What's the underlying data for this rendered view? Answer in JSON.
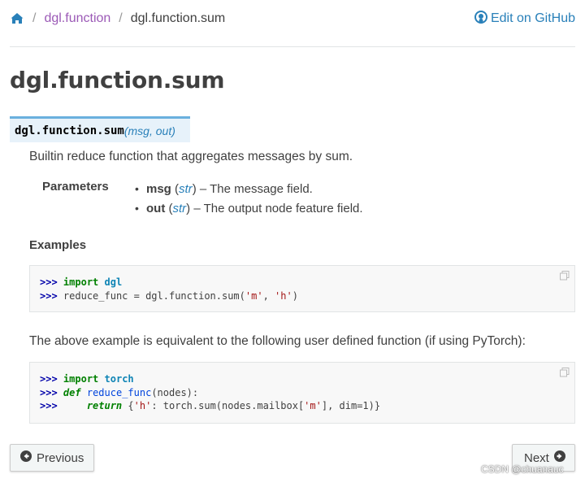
{
  "breadcrumb": {
    "parent": "dgl.function",
    "current": "dgl.function.sum",
    "separator": "/",
    "github": "Edit on GitHub"
  },
  "page_title": "dgl.function.sum",
  "signature": {
    "name": "dgl.function.sum",
    "params": "(msg, out)"
  },
  "description": "Builtin reduce function that aggregates messages by sum.",
  "parameters": {
    "label": "Parameters",
    "items": [
      {
        "name": "msg",
        "type": "str",
        "desc": "– The message field."
      },
      {
        "name": "out",
        "type": "str",
        "desc": "– The output node feature field."
      }
    ]
  },
  "examples_heading": "Examples",
  "code1": {
    "lines": [
      {
        "prompt": ">>>",
        "kw": "import",
        "rest": " ",
        "mod": "dgl"
      },
      {
        "prompt": ">>>",
        "text": "reduce_func = dgl.function.sum(",
        "s1": "'m'",
        "mid": ", ",
        "s2": "'h'",
        "end": ")"
      }
    ]
  },
  "equiv_text": "The above example is equivalent to the following user defined function (if using PyTorch):",
  "code2": {
    "l1": {
      "prompt": ">>>",
      "kw": "import",
      "mod": "torch"
    },
    "l2": {
      "prompt": ">>>",
      "kw": "def",
      "fn": "reduce_func",
      "rest": "(nodes):"
    },
    "l3": {
      "prompt": ">>>",
      "kw": "return",
      "a": "{",
      "s1": "'h'",
      "b": ": torch.sum(nodes.mailbox[",
      "s2": "'m'",
      "c": "], dim=1)}"
    }
  },
  "nav": {
    "previous": "Previous",
    "next": "Next"
  },
  "watermark": "CSDN @chuanauc",
  "colors": {
    "link": "#2980b9",
    "visited": "#9b59b6",
    "sig_bg": "#e7f2fa",
    "sig_border": "#6ab0de"
  }
}
